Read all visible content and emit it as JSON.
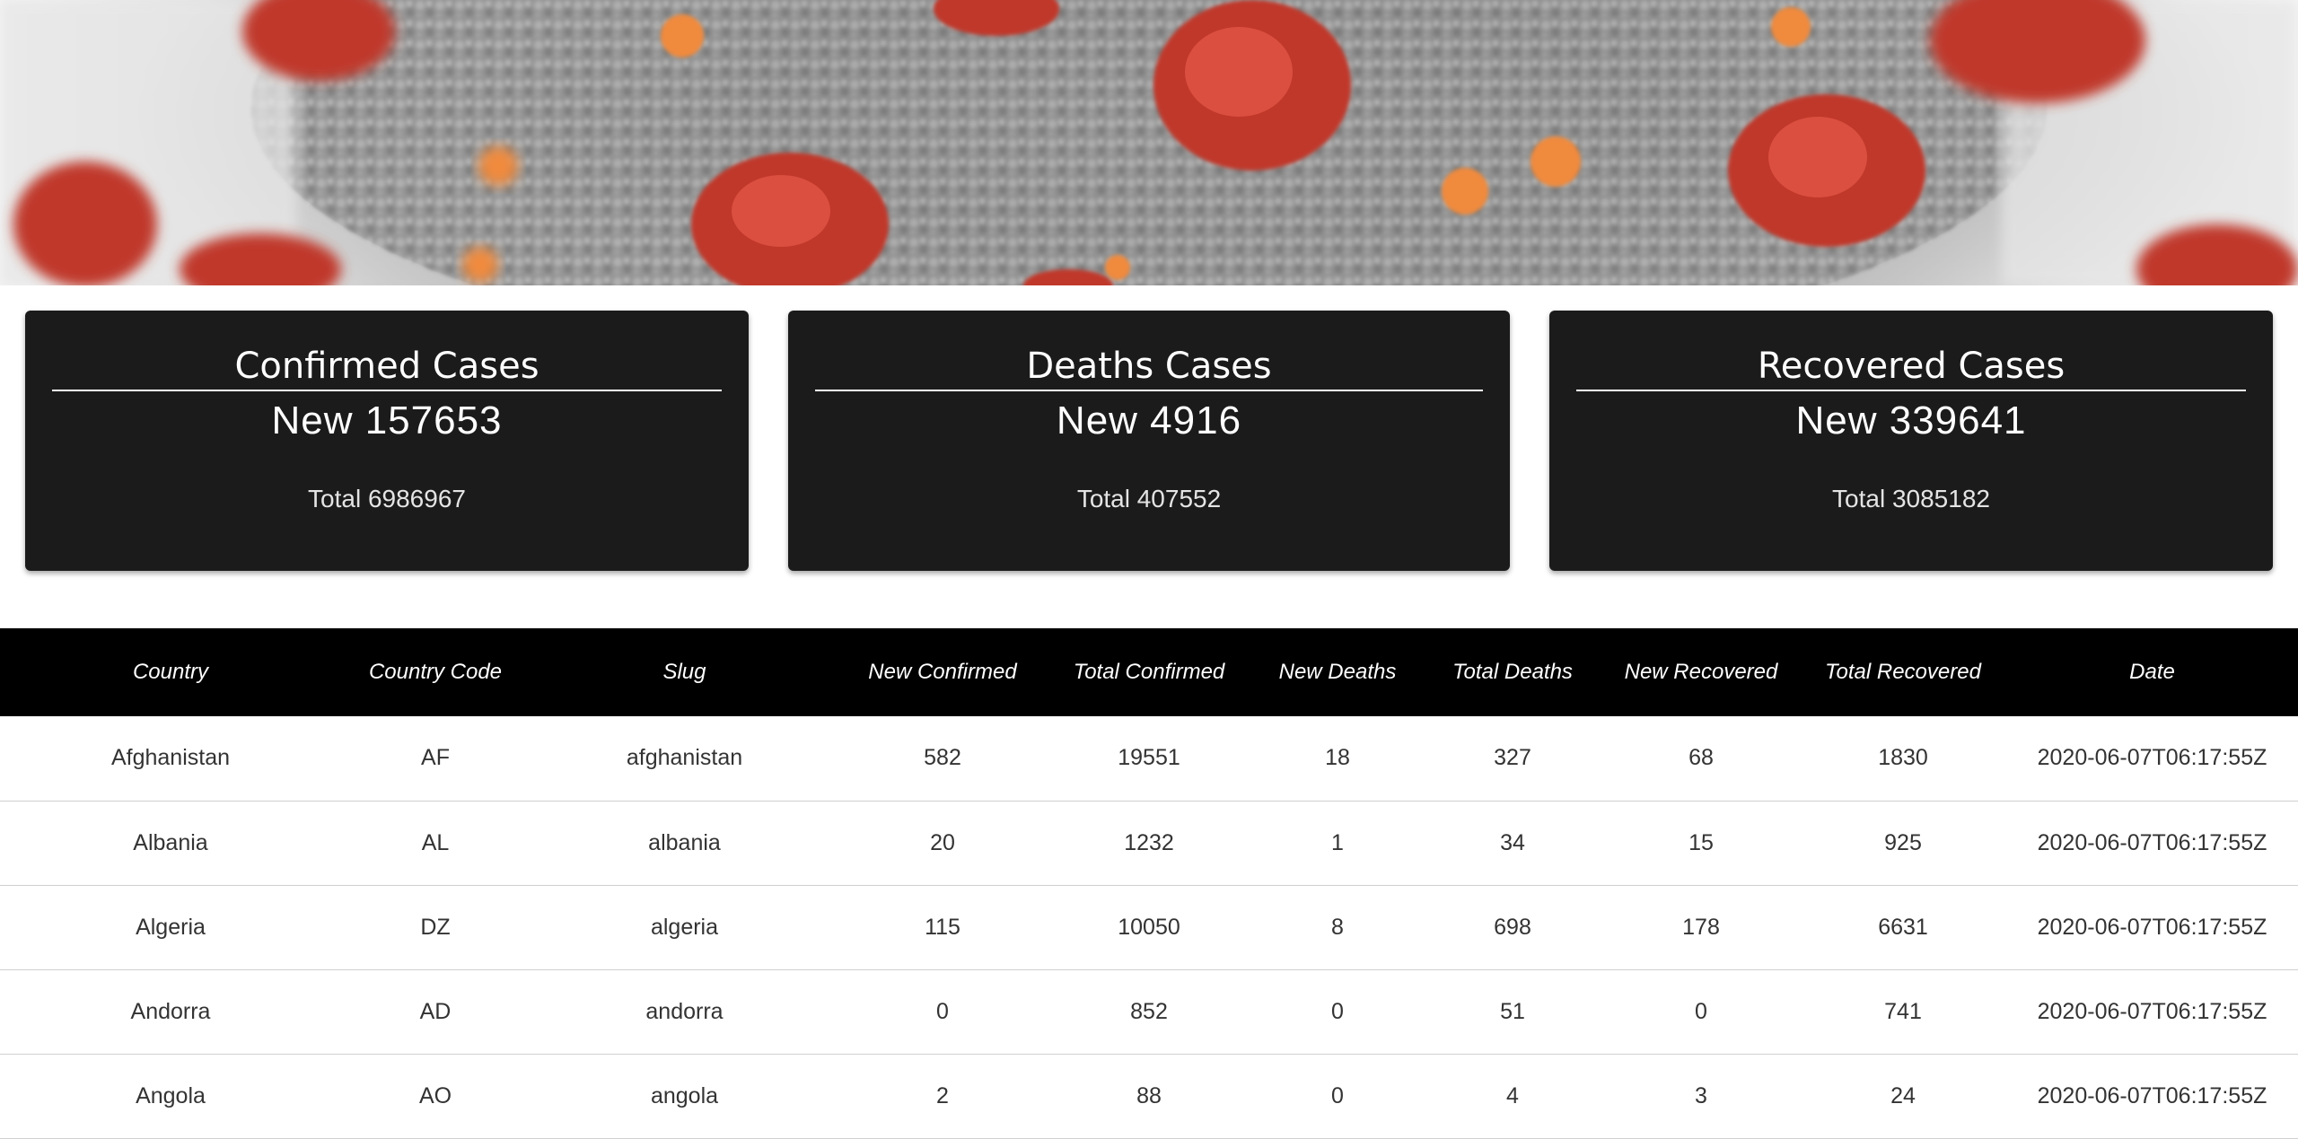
{
  "hero": {
    "image": "coronavirus-banner",
    "colors": {
      "spike": "#c0392b",
      "accent": "#f08a3c",
      "body": "#9a9a9a"
    }
  },
  "cards": [
    {
      "title": "Confirmed Cases",
      "new_text": "New 157653",
      "total_text": "Total 6986967"
    },
    {
      "title": "Deaths Cases",
      "new_text": "New 4916",
      "total_text": "Total 407552"
    },
    {
      "title": "Recovered Cases",
      "new_text": "New 339641",
      "total_text": "Total 3085182"
    }
  ],
  "table": {
    "columns": [
      "Country",
      "Country Code",
      "Slug",
      "New Confirmed",
      "Total Confirmed",
      "New Deaths",
      "Total Deaths",
      "New Recovered",
      "Total Recovered",
      "Date"
    ],
    "rows": [
      [
        "Afghanistan",
        "AF",
        "afghanistan",
        "582",
        "19551",
        "18",
        "327",
        "68",
        "1830",
        "2020-06-07T06:17:55Z"
      ],
      [
        "Albania",
        "AL",
        "albania",
        "20",
        "1232",
        "1",
        "34",
        "15",
        "925",
        "2020-06-07T06:17:55Z"
      ],
      [
        "Algeria",
        "DZ",
        "algeria",
        "115",
        "10050",
        "8",
        "698",
        "178",
        "6631",
        "2020-06-07T06:17:55Z"
      ],
      [
        "Andorra",
        "AD",
        "andorra",
        "0",
        "852",
        "0",
        "51",
        "0",
        "741",
        "2020-06-07T06:17:55Z"
      ],
      [
        "Angola",
        "AO",
        "angola",
        "2",
        "88",
        "0",
        "4",
        "3",
        "24",
        "2020-06-07T06:17:55Z"
      ]
    ]
  }
}
